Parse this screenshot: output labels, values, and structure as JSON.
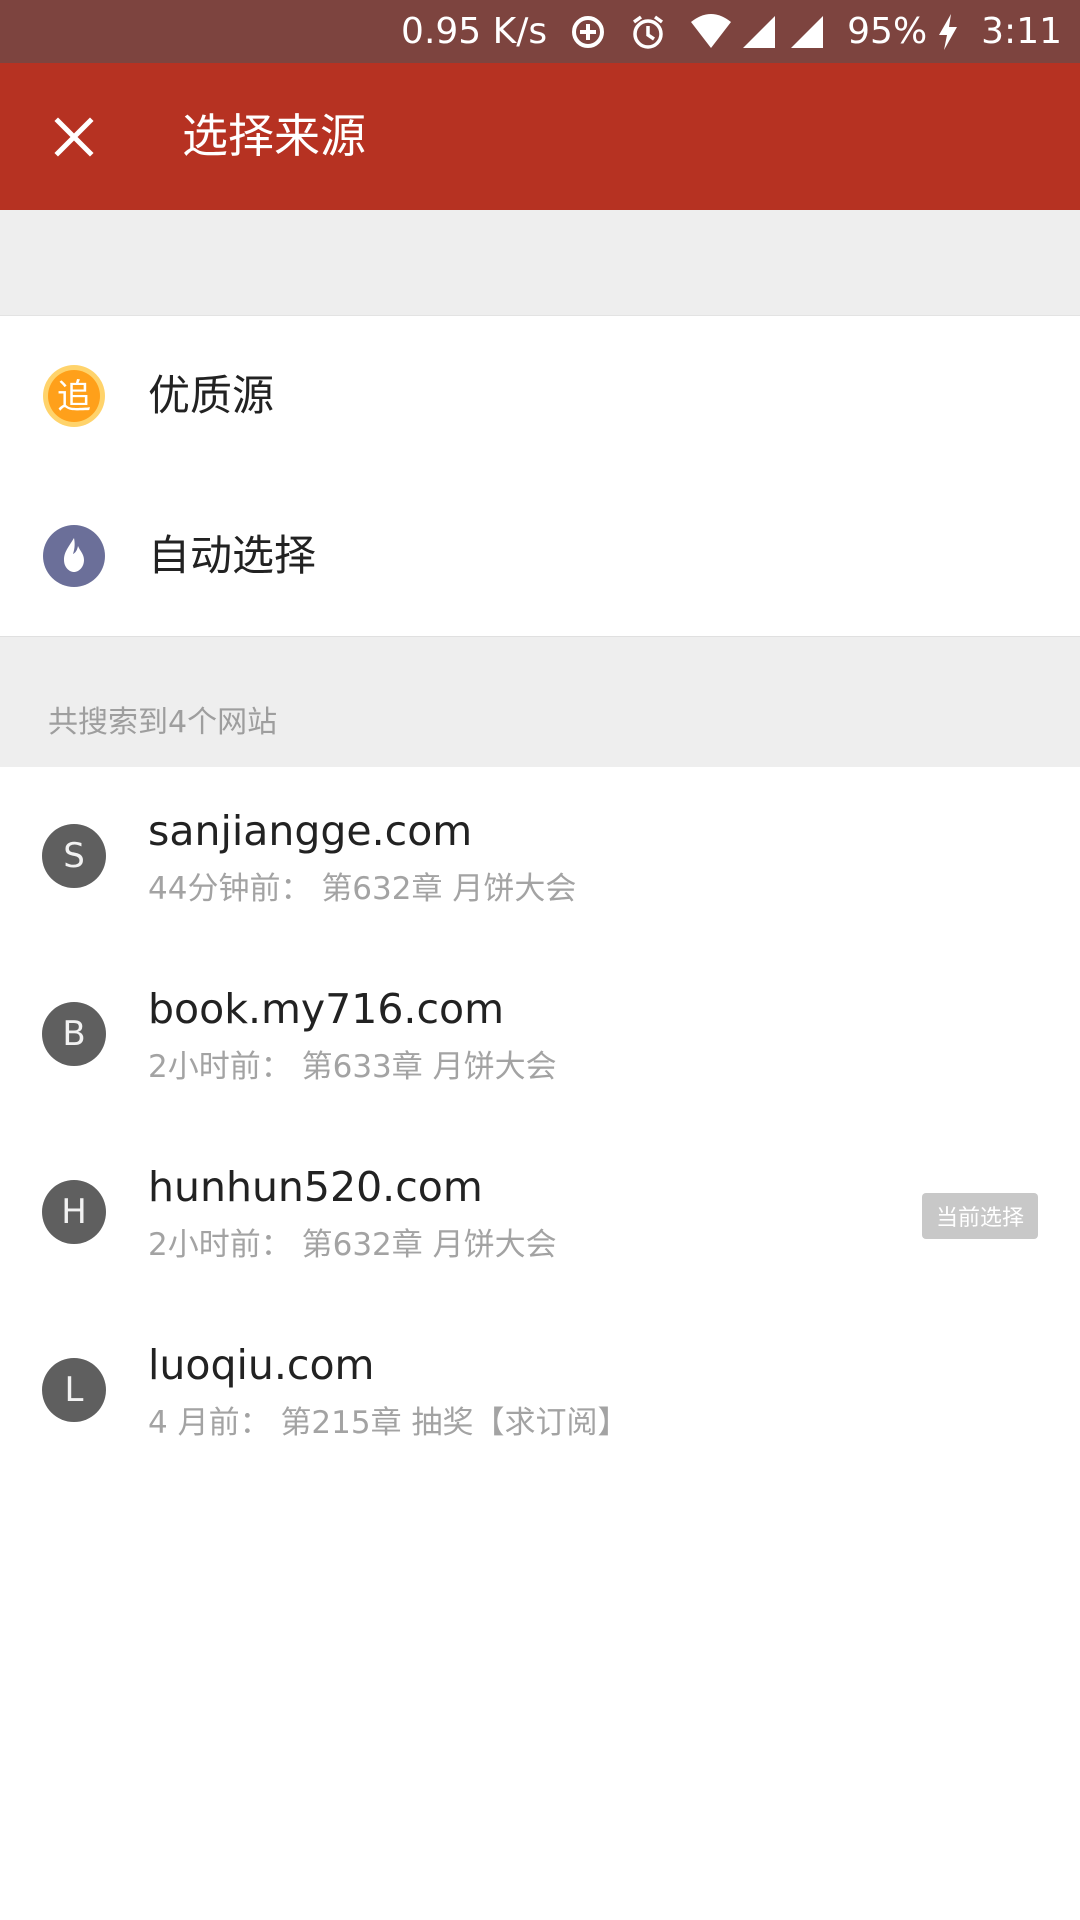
{
  "status_bar": {
    "net_speed": "0.95 K/s",
    "battery": "95%",
    "time": "3:11",
    "icons": [
      "data-saver-icon",
      "alarm-icon",
      "wifi-icon",
      "signal-icon",
      "signal-icon",
      "charging-icon"
    ]
  },
  "app_bar": {
    "title": "选择来源",
    "close_icon": "close-icon",
    "color": "#b63222"
  },
  "options": [
    {
      "label": "优质源",
      "icon": "zhui-badge-icon",
      "icon_text": "追"
    },
    {
      "label": "自动选择",
      "icon": "flame-icon"
    }
  ],
  "section": {
    "header": "共搜索到4个网站"
  },
  "sites": [
    {
      "initial": "S",
      "domain": "sanjiangge.com",
      "time": "44分钟前：",
      "chapter": "第632章 月饼大会",
      "current": false
    },
    {
      "initial": "B",
      "domain": "book.my716.com",
      "time": "2小时前：",
      "chapter": "第633章 月饼大会",
      "current": false
    },
    {
      "initial": "H",
      "domain": "hunhun520.com",
      "time": "2小时前：",
      "chapter": "第632章 月饼大会",
      "current": true
    },
    {
      "initial": "L",
      "domain": "luoqiu.com",
      "time": "4 月前：",
      "chapter": "第215章 抽奖【求订阅】",
      "current": false
    }
  ],
  "current_badge_label": "当前选择"
}
